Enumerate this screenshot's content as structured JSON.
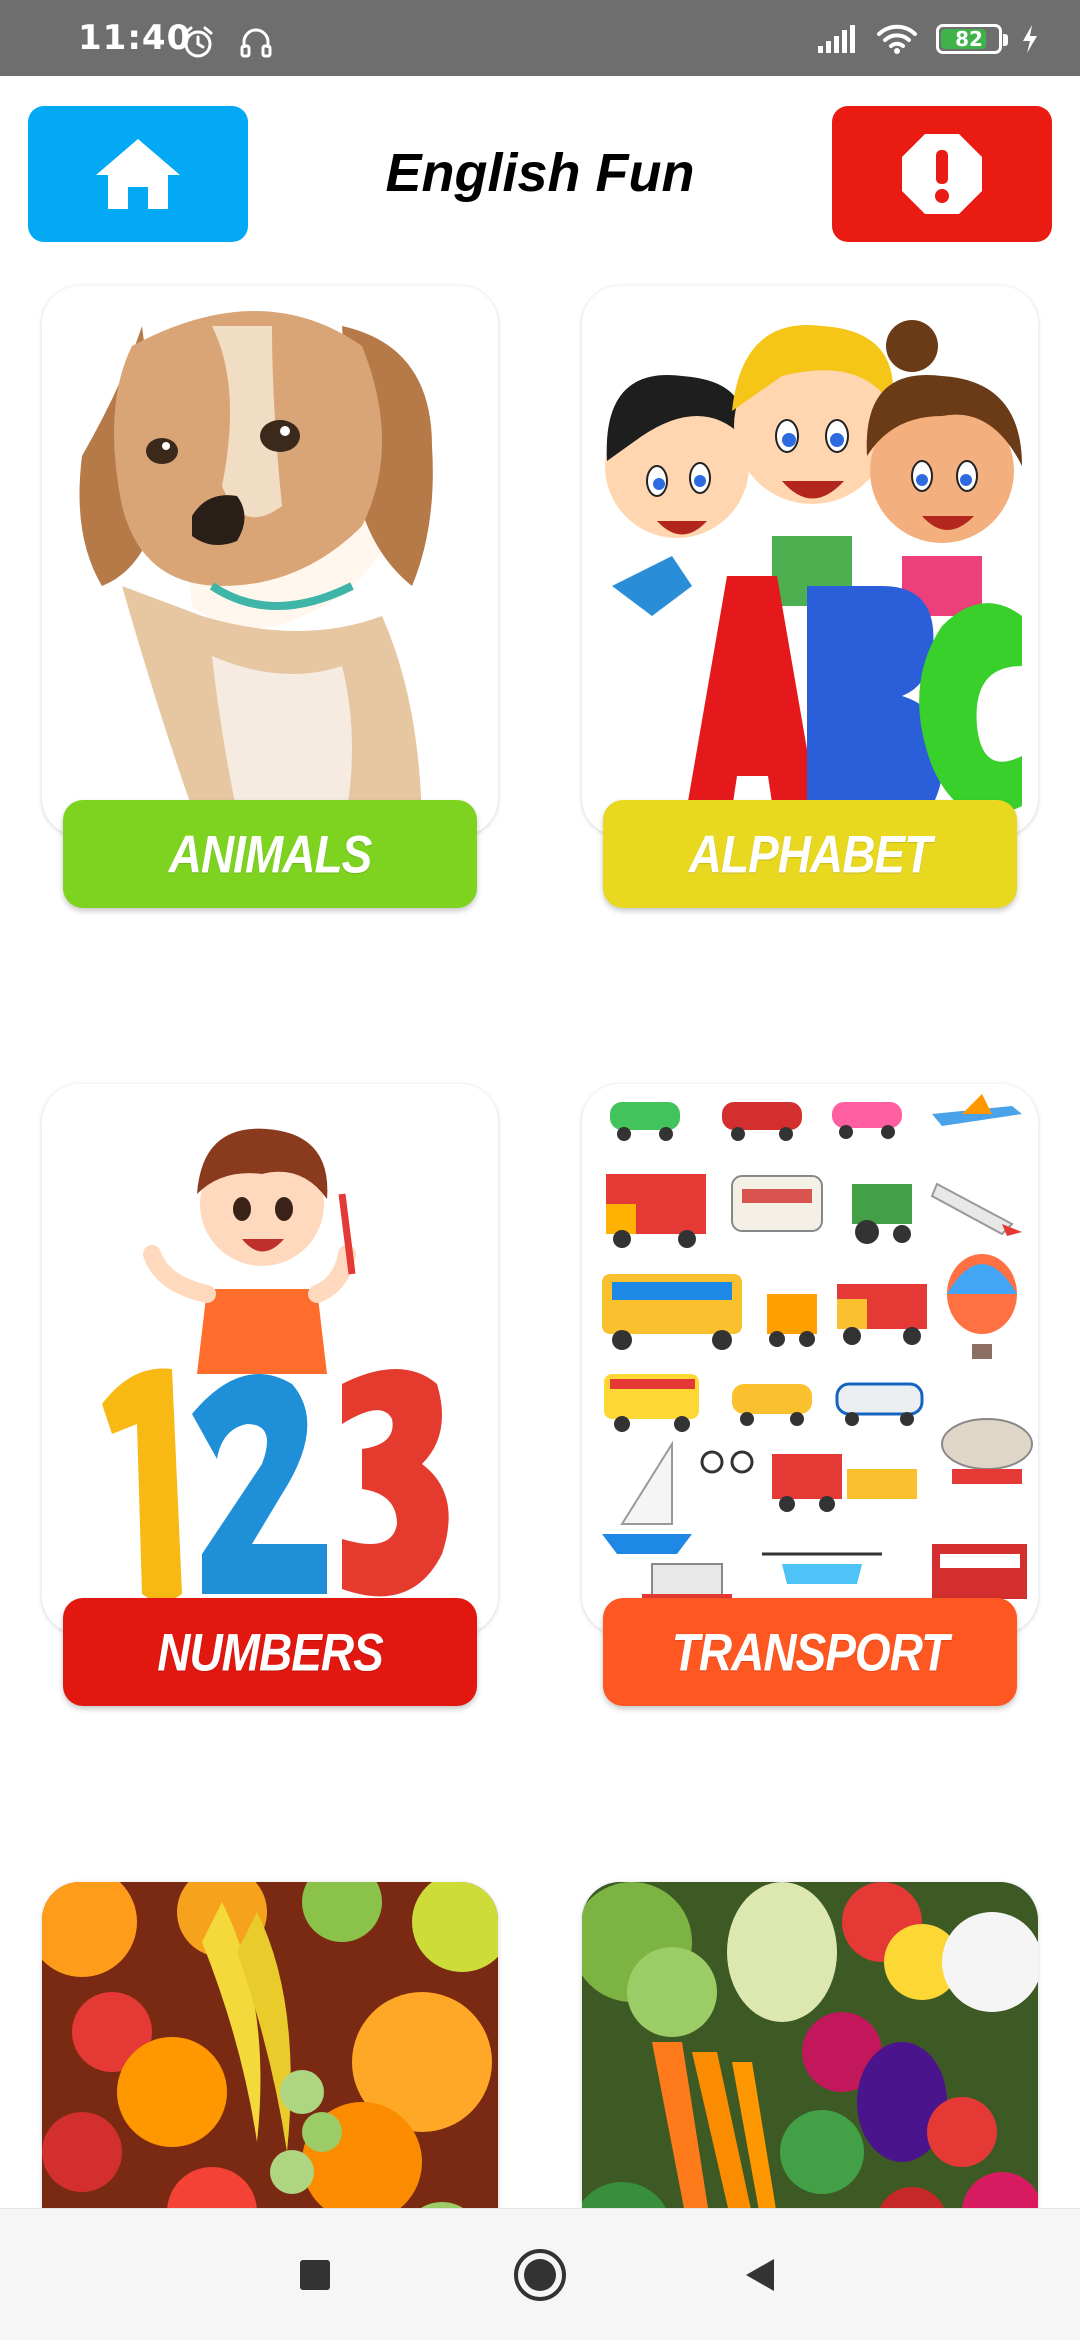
{
  "status_bar": {
    "time": "11:40",
    "left_icons": [
      "alarm-icon",
      "headset-icon"
    ],
    "right_icons": [
      "signal-icon",
      "wifi-icon",
      "battery-icon",
      "charging-icon"
    ],
    "battery_level": "82"
  },
  "header": {
    "title": "English Fun",
    "home_icon": "home-icon",
    "alert_icon": "alert-octagon-icon",
    "colors": {
      "home": "#03a9f4",
      "alert": "#ea1b13"
    }
  },
  "categories": [
    {
      "label": "ANIMALS",
      "color": "#7ed321",
      "image": "puppy-illustration"
    },
    {
      "label": "ALPHABET",
      "color": "#e8d820",
      "image": "abc-kids-illustration"
    },
    {
      "label": "NUMBERS",
      "color": "#e2170f",
      "image": "123-kid-illustration"
    },
    {
      "label": "TRANSPORT",
      "color": "#ff5722",
      "image": "vehicles-illustration"
    },
    {
      "label": "",
      "color": "",
      "image": "fruits-photo"
    },
    {
      "label": "",
      "color": "",
      "image": "vegetables-photo"
    }
  ],
  "nav_bar": {
    "buttons": [
      "recents-square-icon",
      "home-circle-icon",
      "back-triangle-icon"
    ]
  }
}
